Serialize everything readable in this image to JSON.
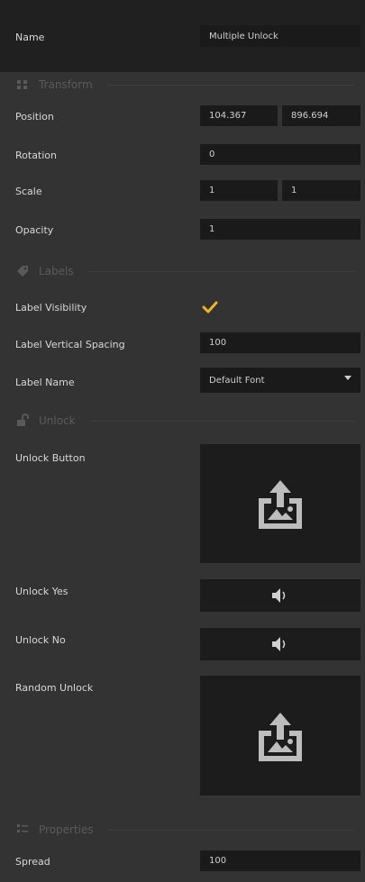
{
  "name": {
    "label": "Name",
    "value": "Multiple Unlock"
  },
  "transform": {
    "title": "Transform",
    "icon": "transform-icon",
    "position_label": "Position",
    "position_x": "104.367",
    "position_y": "896.694",
    "rotation_label": "Rotation",
    "rotation": "0",
    "scale_label": "Scale",
    "scale_x": "1",
    "scale_y": "1",
    "opacity_label": "Opacity",
    "opacity": "1"
  },
  "labels": {
    "title": "Labels",
    "icon": "tag-icon",
    "visibility_label": "Label Visibility",
    "visibility_checked": true,
    "spacing_label": "Label Vertical Spacing",
    "spacing": "100",
    "name_label": "Label Name",
    "name_value": "Default Font"
  },
  "unlock": {
    "title": "Unlock",
    "icon": "unlock-icon",
    "button_label": "Unlock Button",
    "yes_label": "Unlock Yes",
    "no_label": "Unlock No",
    "random_label": "Random Unlock"
  },
  "properties": {
    "title": "Properties",
    "icon": "properties-icon",
    "spread_label": "Spread",
    "spread": "100"
  },
  "colors": {
    "background": "#333333",
    "field": "#1a1a1a",
    "accent_check": "#f0b429"
  }
}
